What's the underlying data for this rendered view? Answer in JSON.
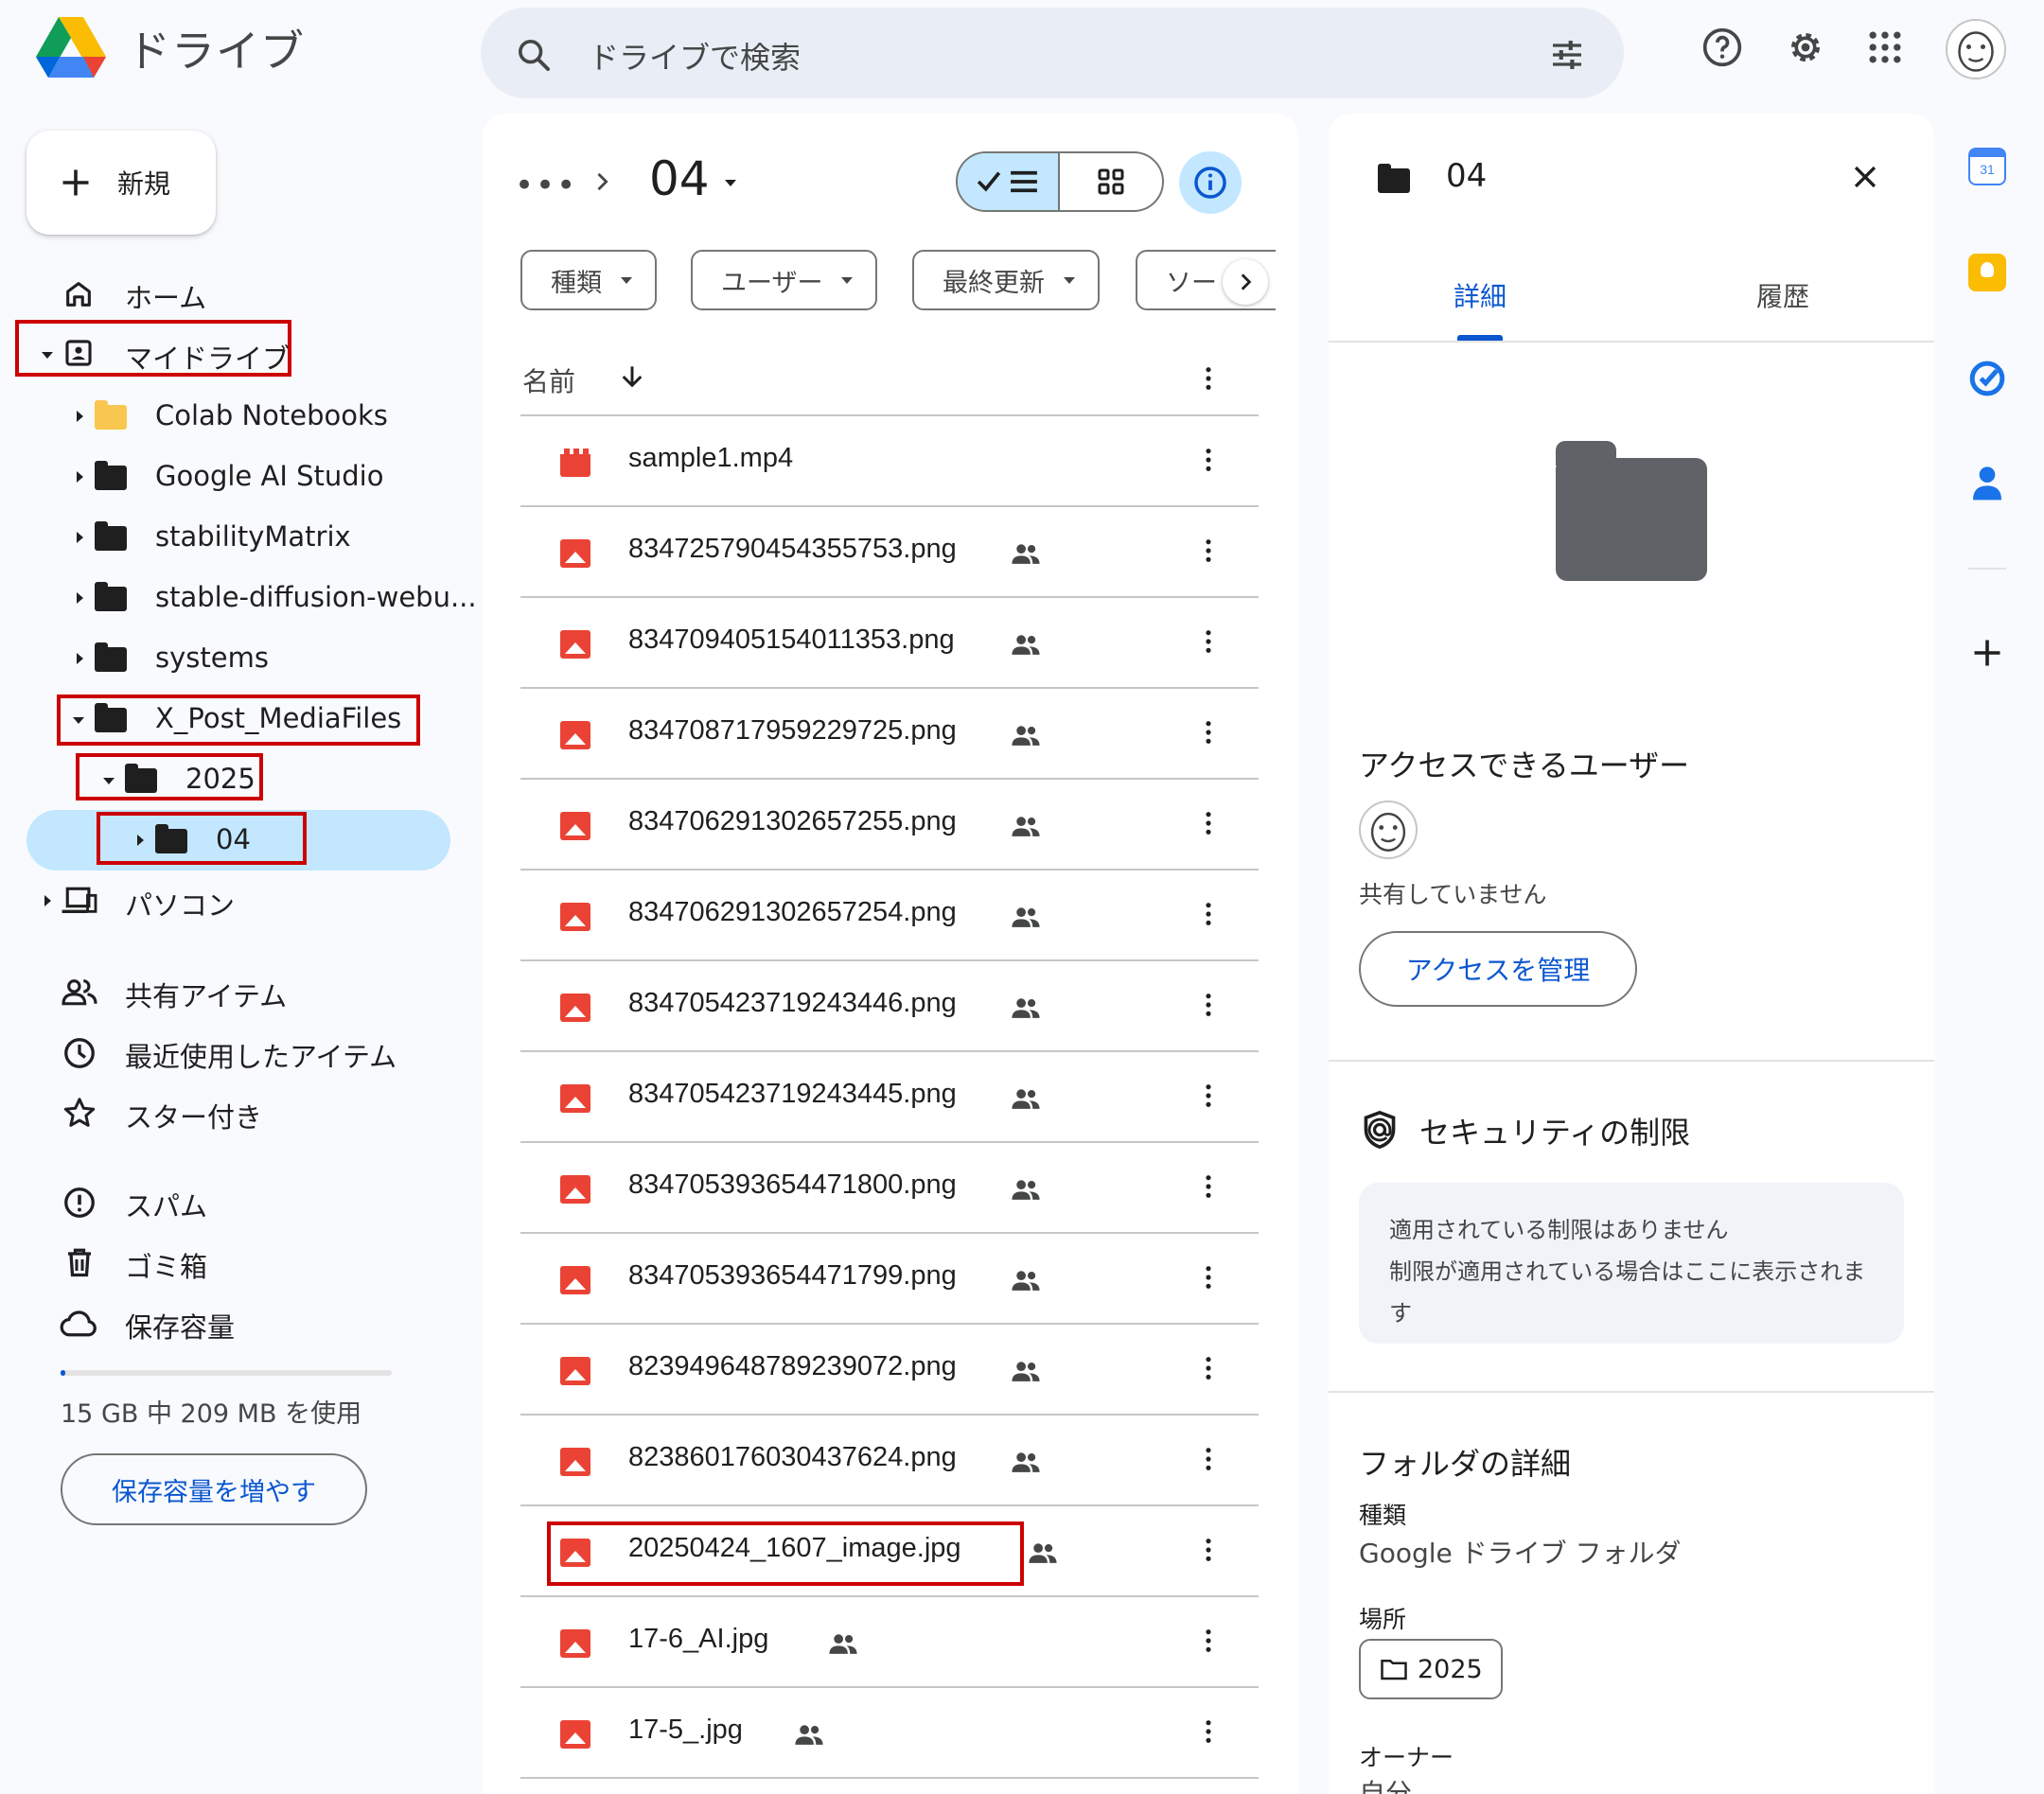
{
  "app": {
    "name": "ドライブ"
  },
  "search": {
    "placeholder": "ドライブで検索"
  },
  "new_button": {
    "label": "新規"
  },
  "nav": {
    "home": "ホーム",
    "my_drive": "マイドライブ",
    "tree": [
      {
        "label": "Colab Notebooks"
      },
      {
        "label": "Google AI Studio"
      },
      {
        "label": "stabilityMatrix"
      },
      {
        "label": "stable-diffusion-webu..."
      },
      {
        "label": "systems"
      },
      {
        "label": "X_Post_MediaFiles"
      },
      {
        "label": "2025"
      },
      {
        "label": "04"
      }
    ],
    "computers": "パソコン",
    "shared": "共有アイテム",
    "recent": "最近使用したアイテム",
    "starred": "スター付き",
    "spam": "スパム",
    "trash": "ゴミ箱",
    "storage": "保存容量"
  },
  "storage": {
    "used_fraction": 0.014,
    "text": "15 GB 中 209 MB を使用",
    "button": "保存容量を増やす"
  },
  "main": {
    "breadcrumb_more": "•••",
    "folder_title": "04",
    "filters": [
      "種類",
      "ユーザー",
      "最終更新",
      "ソー"
    ],
    "column_name": "名前",
    "files": [
      {
        "name": "sample1.mp4",
        "type": "video",
        "shared": false
      },
      {
        "name": "834725790454355753.png",
        "type": "image",
        "shared": true
      },
      {
        "name": "834709405154011353.png",
        "type": "image",
        "shared": true
      },
      {
        "name": "834708717959229725.png",
        "type": "image",
        "shared": true
      },
      {
        "name": "834706291302657255.png",
        "type": "image",
        "shared": true
      },
      {
        "name": "834706291302657254.png",
        "type": "image",
        "shared": true
      },
      {
        "name": "834705423719243446.png",
        "type": "image",
        "shared": true
      },
      {
        "name": "834705423719243445.png",
        "type": "image",
        "shared": true
      },
      {
        "name": "834705393654471800.png",
        "type": "image",
        "shared": true
      },
      {
        "name": "834705393654471799.png",
        "type": "image",
        "shared": true
      },
      {
        "name": "823949648789239072.png",
        "type": "image",
        "shared": true
      },
      {
        "name": "823860176030437624.png",
        "type": "image",
        "shared": true
      },
      {
        "name": "20250424_1607_image.jpg",
        "type": "image",
        "shared": true
      },
      {
        "name": "17-6_AI.jpg",
        "type": "image",
        "shared": true
      },
      {
        "name": "17-5_.jpg",
        "type": "image",
        "shared": true
      }
    ]
  },
  "details": {
    "title": "04",
    "tabs": [
      "詳細",
      "履歴"
    ],
    "access_title": "アクセスできるユーザー",
    "not_shared": "共有していません",
    "manage_access": "アクセスを管理",
    "security_title": "セキュリティの制限",
    "security_line1": "適用されている制限はありません",
    "security_line2": "制限が適用されている場合はここに表示されます",
    "folder_details_title": "フォルダの詳細",
    "type_label": "種類",
    "type_value": "Google ドライブ フォルダ",
    "location_label": "場所",
    "location_value": "2025",
    "owner_label": "オーナー",
    "owner_value": "自分"
  },
  "colors": {
    "accent_blue": "#0b57d0",
    "selected_bg": "#c2e7ff",
    "image_icon": "#ea4335",
    "annotation_red": "#cc0000"
  }
}
